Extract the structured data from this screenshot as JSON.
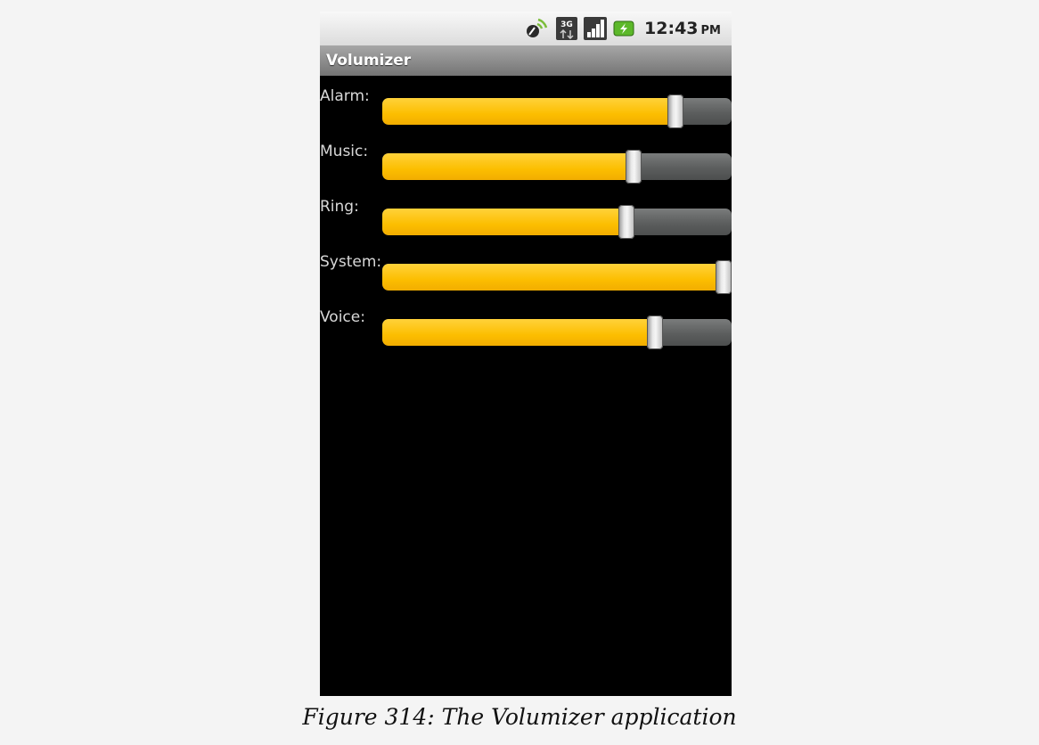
{
  "status_bar": {
    "time": "12:43",
    "ampm": "PM",
    "icons": [
      "gps-icon",
      "3g-data-icon",
      "signal-icon",
      "battery-charging-icon"
    ],
    "network_label": "3G"
  },
  "app": {
    "title": "Volumizer"
  },
  "volumes": [
    {
      "label": "Alarm:",
      "level": 0.84
    },
    {
      "label": "Music:",
      "level": 0.72
    },
    {
      "label": "Ring:",
      "level": 0.7
    },
    {
      "label": "System:",
      "level": 1.0
    },
    {
      "label": "Voice:",
      "level": 0.78
    }
  ],
  "caption": "Figure 314: The Volumizer application",
  "colors": {
    "fill": "#fcbe00",
    "track": "#5c5e5e",
    "title_bar": "#8a8a8a"
  }
}
